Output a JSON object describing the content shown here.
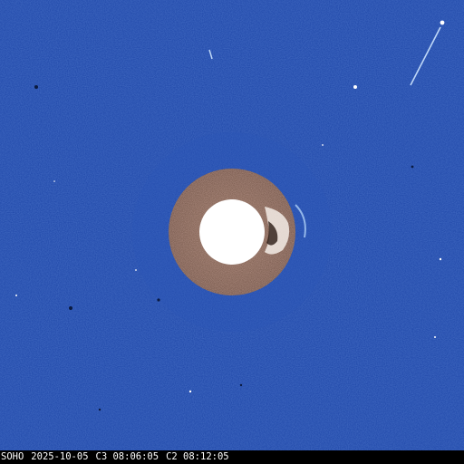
{
  "image": {
    "instrument": "SOHO",
    "date": "2025-10-05",
    "c3_label": "C3 08:06:05",
    "c2_label": "C2 08:12:05"
  },
  "colors": {
    "sky": "#1c44a6",
    "occulter": "#ffffff",
    "inner_field": "#7a5a4a",
    "caption_bg": "#000000",
    "caption_text": "#ffffff"
  }
}
